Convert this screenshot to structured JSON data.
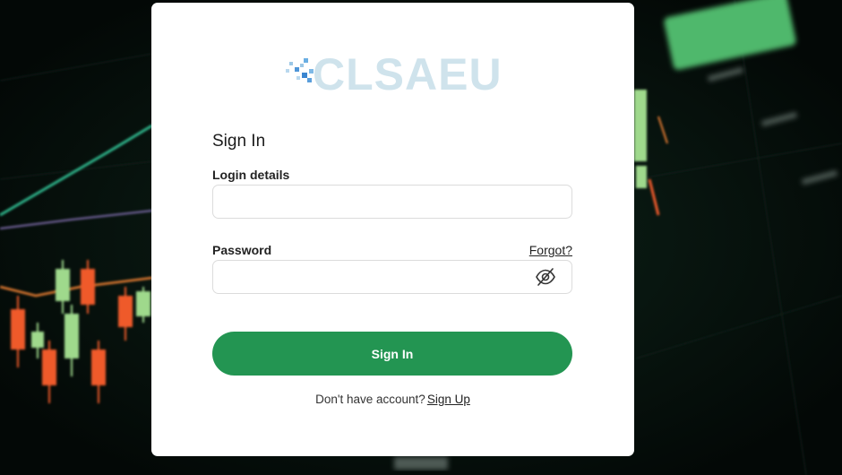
{
  "brand": {
    "name": "CLSAEU"
  },
  "form": {
    "title": "Sign In",
    "login_label": "Login details",
    "login_value": "",
    "password_label": "Password",
    "password_value": "",
    "forgot_label": "Forgot?",
    "submit_label": "Sign In",
    "no_account_text": "Don't have account?",
    "signup_label": "Sign Up",
    "password_toggle_icon": "eye-slash-icon"
  },
  "background": {
    "candle_colors": {
      "up": "#9fd98c",
      "down": "#ef5a2c"
    },
    "badge_text": "",
    "accent": "#239552"
  }
}
